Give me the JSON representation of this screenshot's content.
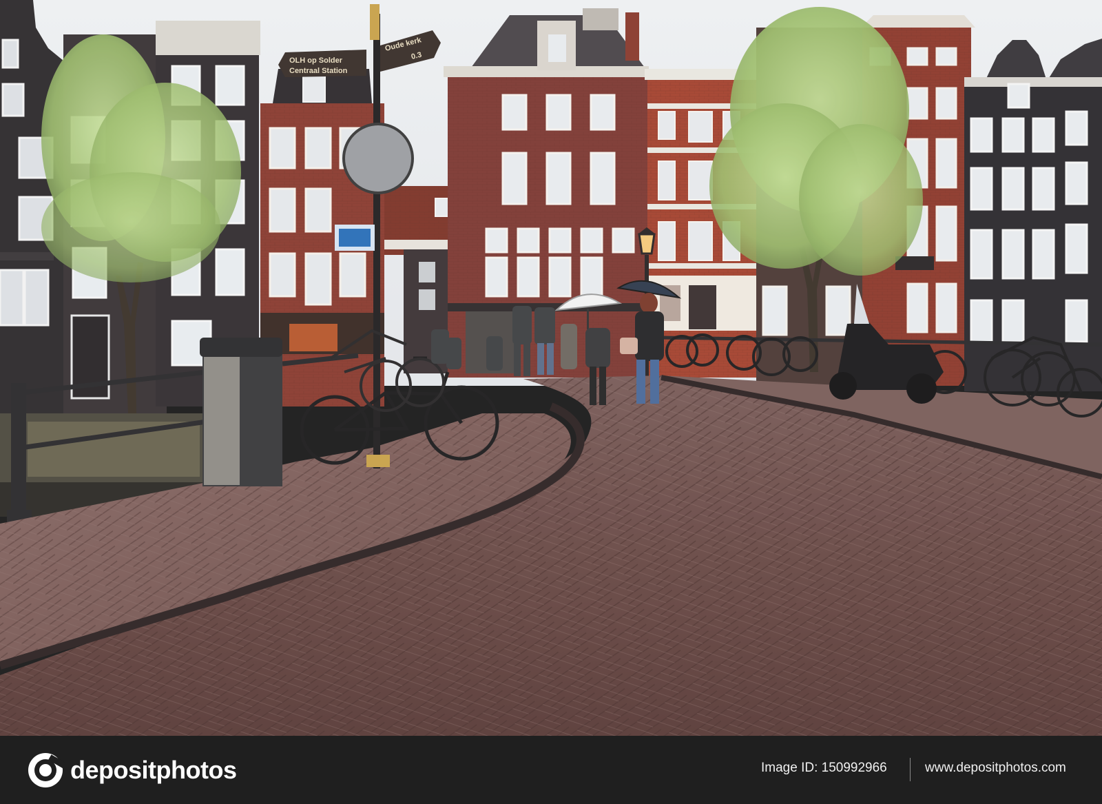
{
  "photo": {
    "signpost": {
      "left_sign_line1": "OLH op Solder",
      "left_sign_line2": "Centraal Station",
      "right_sign_line1": "Oude kerk",
      "right_sign_distance": "0.3"
    },
    "colors": {
      "sky": "#e9ecef",
      "cobblestone": "#6b4a45",
      "brick_red": "#8a3b2e",
      "dark_facade": "#2b2a2d",
      "tree_green": "#a8c77a"
    }
  },
  "footer": {
    "brand": "depositphotos",
    "image_id": "Image ID: 150992966",
    "site_url": "www.depositphotos.com",
    "logo_icon": "camera-aperture-icon"
  }
}
